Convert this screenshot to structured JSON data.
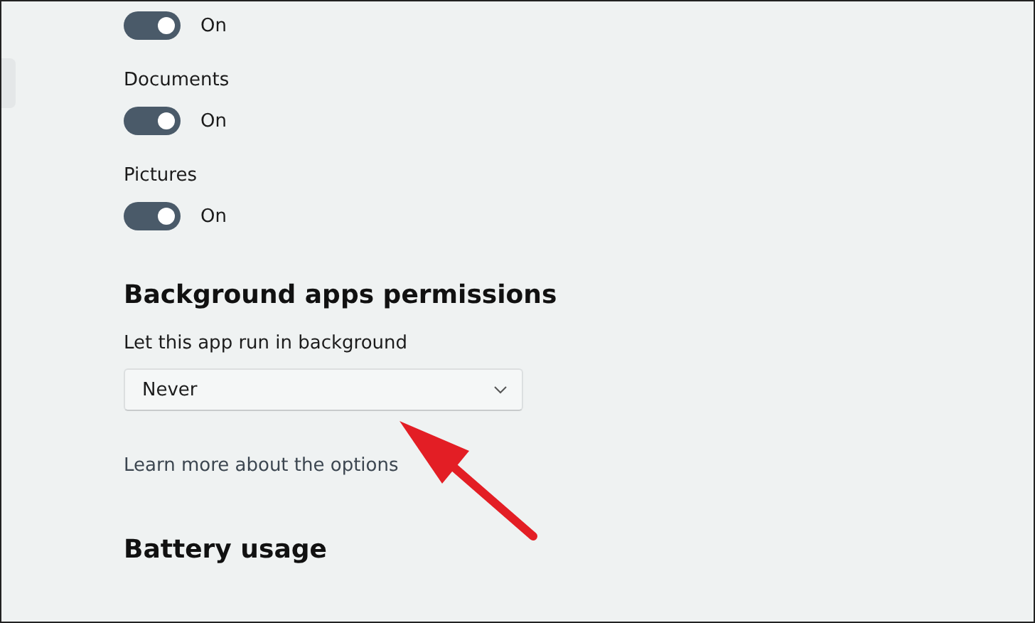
{
  "toggles": [
    {
      "on": true,
      "state_text": "On"
    },
    {
      "label": "Documents",
      "on": true,
      "state_text": "On"
    },
    {
      "label": "Pictures",
      "on": true,
      "state_text": "On"
    }
  ],
  "background_section": {
    "heading": "Background apps permissions",
    "field_label": "Let this app run in background",
    "dropdown_value": "Never",
    "link": "Learn more about the options"
  },
  "battery_section": {
    "heading": "Battery usage"
  }
}
